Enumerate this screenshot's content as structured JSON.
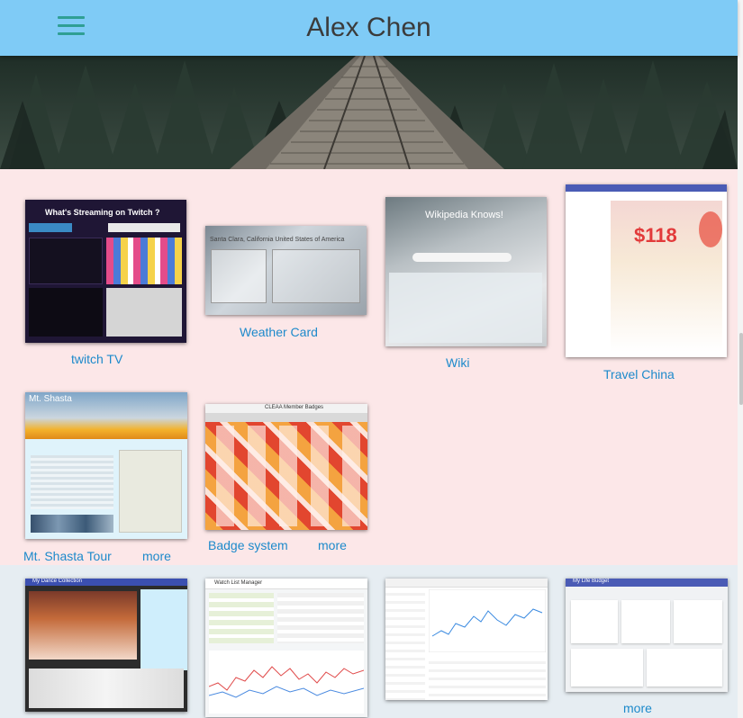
{
  "header": {
    "title": "Alex Chen",
    "menu_icon": "hamburger-menu-icon",
    "background": "#7fcbf6",
    "accent": "#2f9f94"
  },
  "section_colors": {
    "pink": "#fce7e8",
    "blue": "#e6edf2",
    "link": "#1d8acb"
  },
  "projects_row1": [
    {
      "label": "twitch TV",
      "thumb_caption": "What's Streaming on Twitch ?"
    },
    {
      "label": "Weather Card",
      "thumb_caption": "Santa Clara, California United States of America"
    },
    {
      "label": "Wiki",
      "thumb_caption": "Wikipedia Knows!"
    },
    {
      "label": "Travel China",
      "thumb_caption": "$118"
    }
  ],
  "projects_row2": [
    {
      "label": "Mt. Shasta Tour",
      "more": "more",
      "thumb_caption": "Mt. Shasta"
    },
    {
      "label": "Badge system",
      "more": "more",
      "thumb_caption": "CLEAA Member Badges"
    }
  ],
  "projects_row3": [
    {
      "thumb_caption": "My Dance Collection"
    },
    {
      "thumb_caption": "Watch List Manager"
    },
    {
      "thumb_caption": ""
    },
    {
      "thumb_caption": "My Life Budget"
    }
  ],
  "row3_more": "more"
}
